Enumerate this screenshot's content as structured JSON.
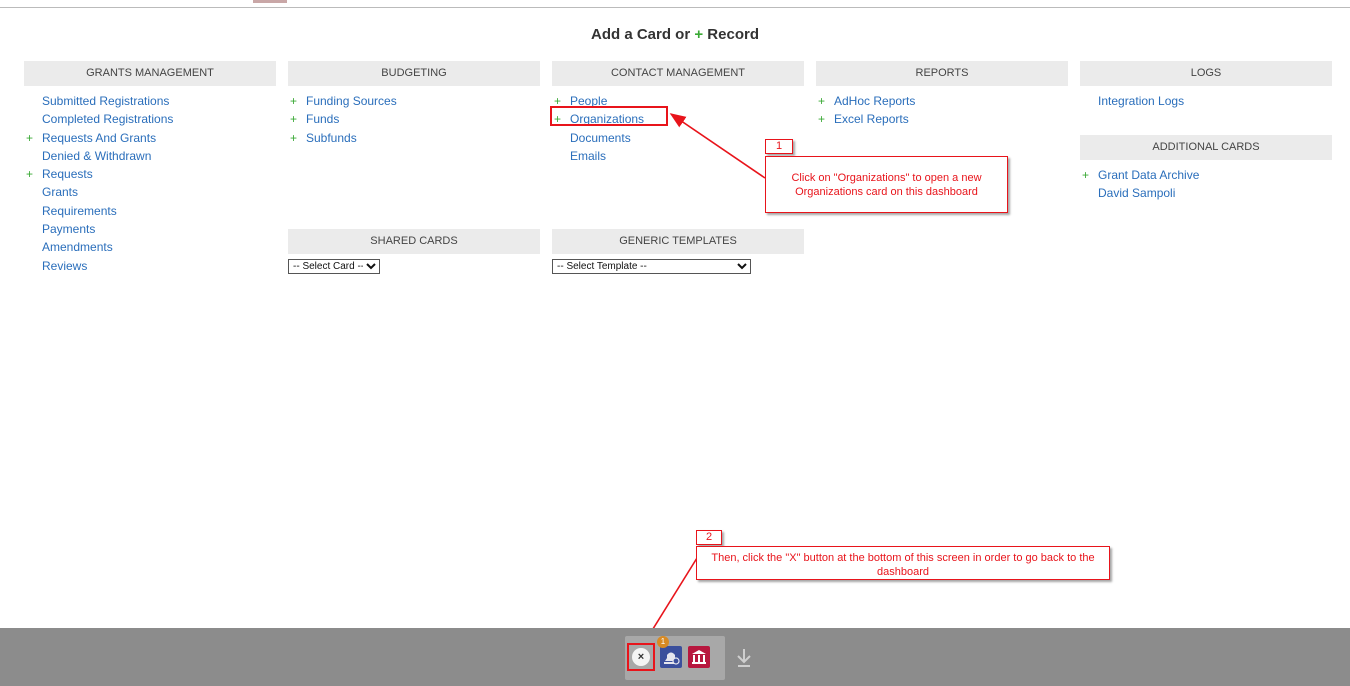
{
  "title": {
    "prefix": "Add a Card or",
    "plus": "+",
    "suffix": "Record"
  },
  "columns": {
    "grants": {
      "header": "GRANTS MANAGEMENT",
      "items": [
        {
          "label": "Submitted Registrations",
          "plus": ""
        },
        {
          "label": "Completed Registrations",
          "plus": ""
        },
        {
          "label": "Requests And Grants",
          "plus": "+"
        },
        {
          "label": "Denied & Withdrawn",
          "plus": ""
        },
        {
          "label": "Requests",
          "plus": "+"
        },
        {
          "label": "Grants",
          "plus": ""
        },
        {
          "label": "Requirements",
          "plus": ""
        },
        {
          "label": "Payments",
          "plus": ""
        },
        {
          "label": "Amendments",
          "plus": ""
        },
        {
          "label": "Reviews",
          "plus": ""
        }
      ]
    },
    "budgeting": {
      "header": "BUDGETING",
      "items": [
        {
          "label": "Funding Sources",
          "plus": "+"
        },
        {
          "label": "Funds",
          "plus": "+"
        },
        {
          "label": "Subfunds",
          "plus": "+"
        }
      ]
    },
    "contact": {
      "header": "CONTACT MANAGEMENT",
      "items": [
        {
          "label": "People",
          "plus": "+"
        },
        {
          "label": "Organizations",
          "plus": "+"
        },
        {
          "label": "Documents",
          "plus": ""
        },
        {
          "label": "Emails",
          "plus": ""
        }
      ]
    },
    "reports": {
      "header": "REPORTS",
      "items": [
        {
          "label": "AdHoc Reports",
          "plus": "+"
        },
        {
          "label": "Excel Reports",
          "plus": "+"
        }
      ]
    },
    "logs": {
      "header": "LOGS",
      "items": [
        {
          "label": "Integration Logs",
          "plus": ""
        }
      ]
    },
    "additional": {
      "header": "ADDITIONAL CARDS",
      "items": [
        {
          "label": "Grant Data Archive",
          "plus": "+"
        },
        {
          "label": "David Sampoli",
          "plus": ""
        }
      ]
    },
    "shared": {
      "header": "SHARED CARDS",
      "select_value": "-- Select Card --"
    },
    "templates": {
      "header": "GENERIC TEMPLATES",
      "select_value": "-- Select Template --"
    }
  },
  "annotations": {
    "step1_number": "1",
    "step1_text": "Click on \"Organizations\" to open a new Organizations card on this dashboard",
    "step2_number": "2",
    "step2_text": "Then, click the \"X\" button at the bottom of this screen in order to go back to the dashboard"
  },
  "dock": {
    "close_label": "×",
    "badge_count": "1",
    "icons": [
      "close-icon",
      "notification-bell-icon",
      "bank-icon",
      "download-icon"
    ]
  },
  "colors": {
    "link": "#2a6ebb",
    "plus": "#3aa935",
    "annotation": "#e8141b",
    "header_bg": "#ebebeb",
    "bottom_bar": "#8c8c8c",
    "bell_button": "#3b4f9c",
    "bank_button": "#b7173e"
  }
}
